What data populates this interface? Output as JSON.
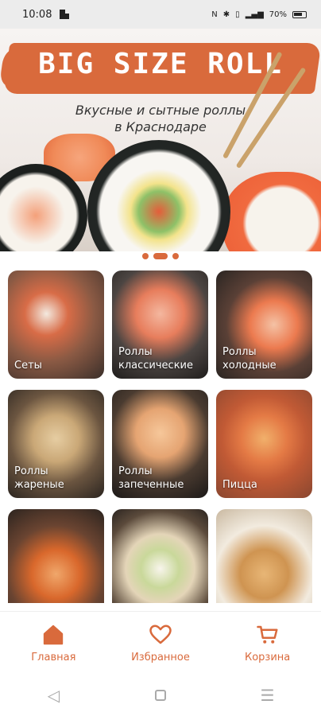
{
  "status_bar": {
    "time": "10:08",
    "battery": "70%"
  },
  "banner": {
    "logo": "BIG SIZE ROLL",
    "tagline_line1": "Вкусные и сытные роллы",
    "tagline_line2": "в Краснодаре"
  },
  "carousel": {
    "count": 3,
    "active_index": 1
  },
  "categories": [
    {
      "label": "Сеты"
    },
    {
      "label": "Роллы\nклассические"
    },
    {
      "label": "Роллы\nхолодные"
    },
    {
      "label": "Роллы\nжареные"
    },
    {
      "label": "Роллы\nзапеченные"
    },
    {
      "label": "Пицца"
    },
    {
      "label": ""
    },
    {
      "label": ""
    },
    {
      "label": ""
    }
  ],
  "bottom_nav": {
    "home": "Главная",
    "favorites": "Избранное",
    "cart": "Корзина"
  },
  "colors": {
    "accent": "#d96a3c"
  },
  "icons": {
    "home": "home-icon",
    "favorites": "heart-icon",
    "cart": "cart-icon"
  }
}
